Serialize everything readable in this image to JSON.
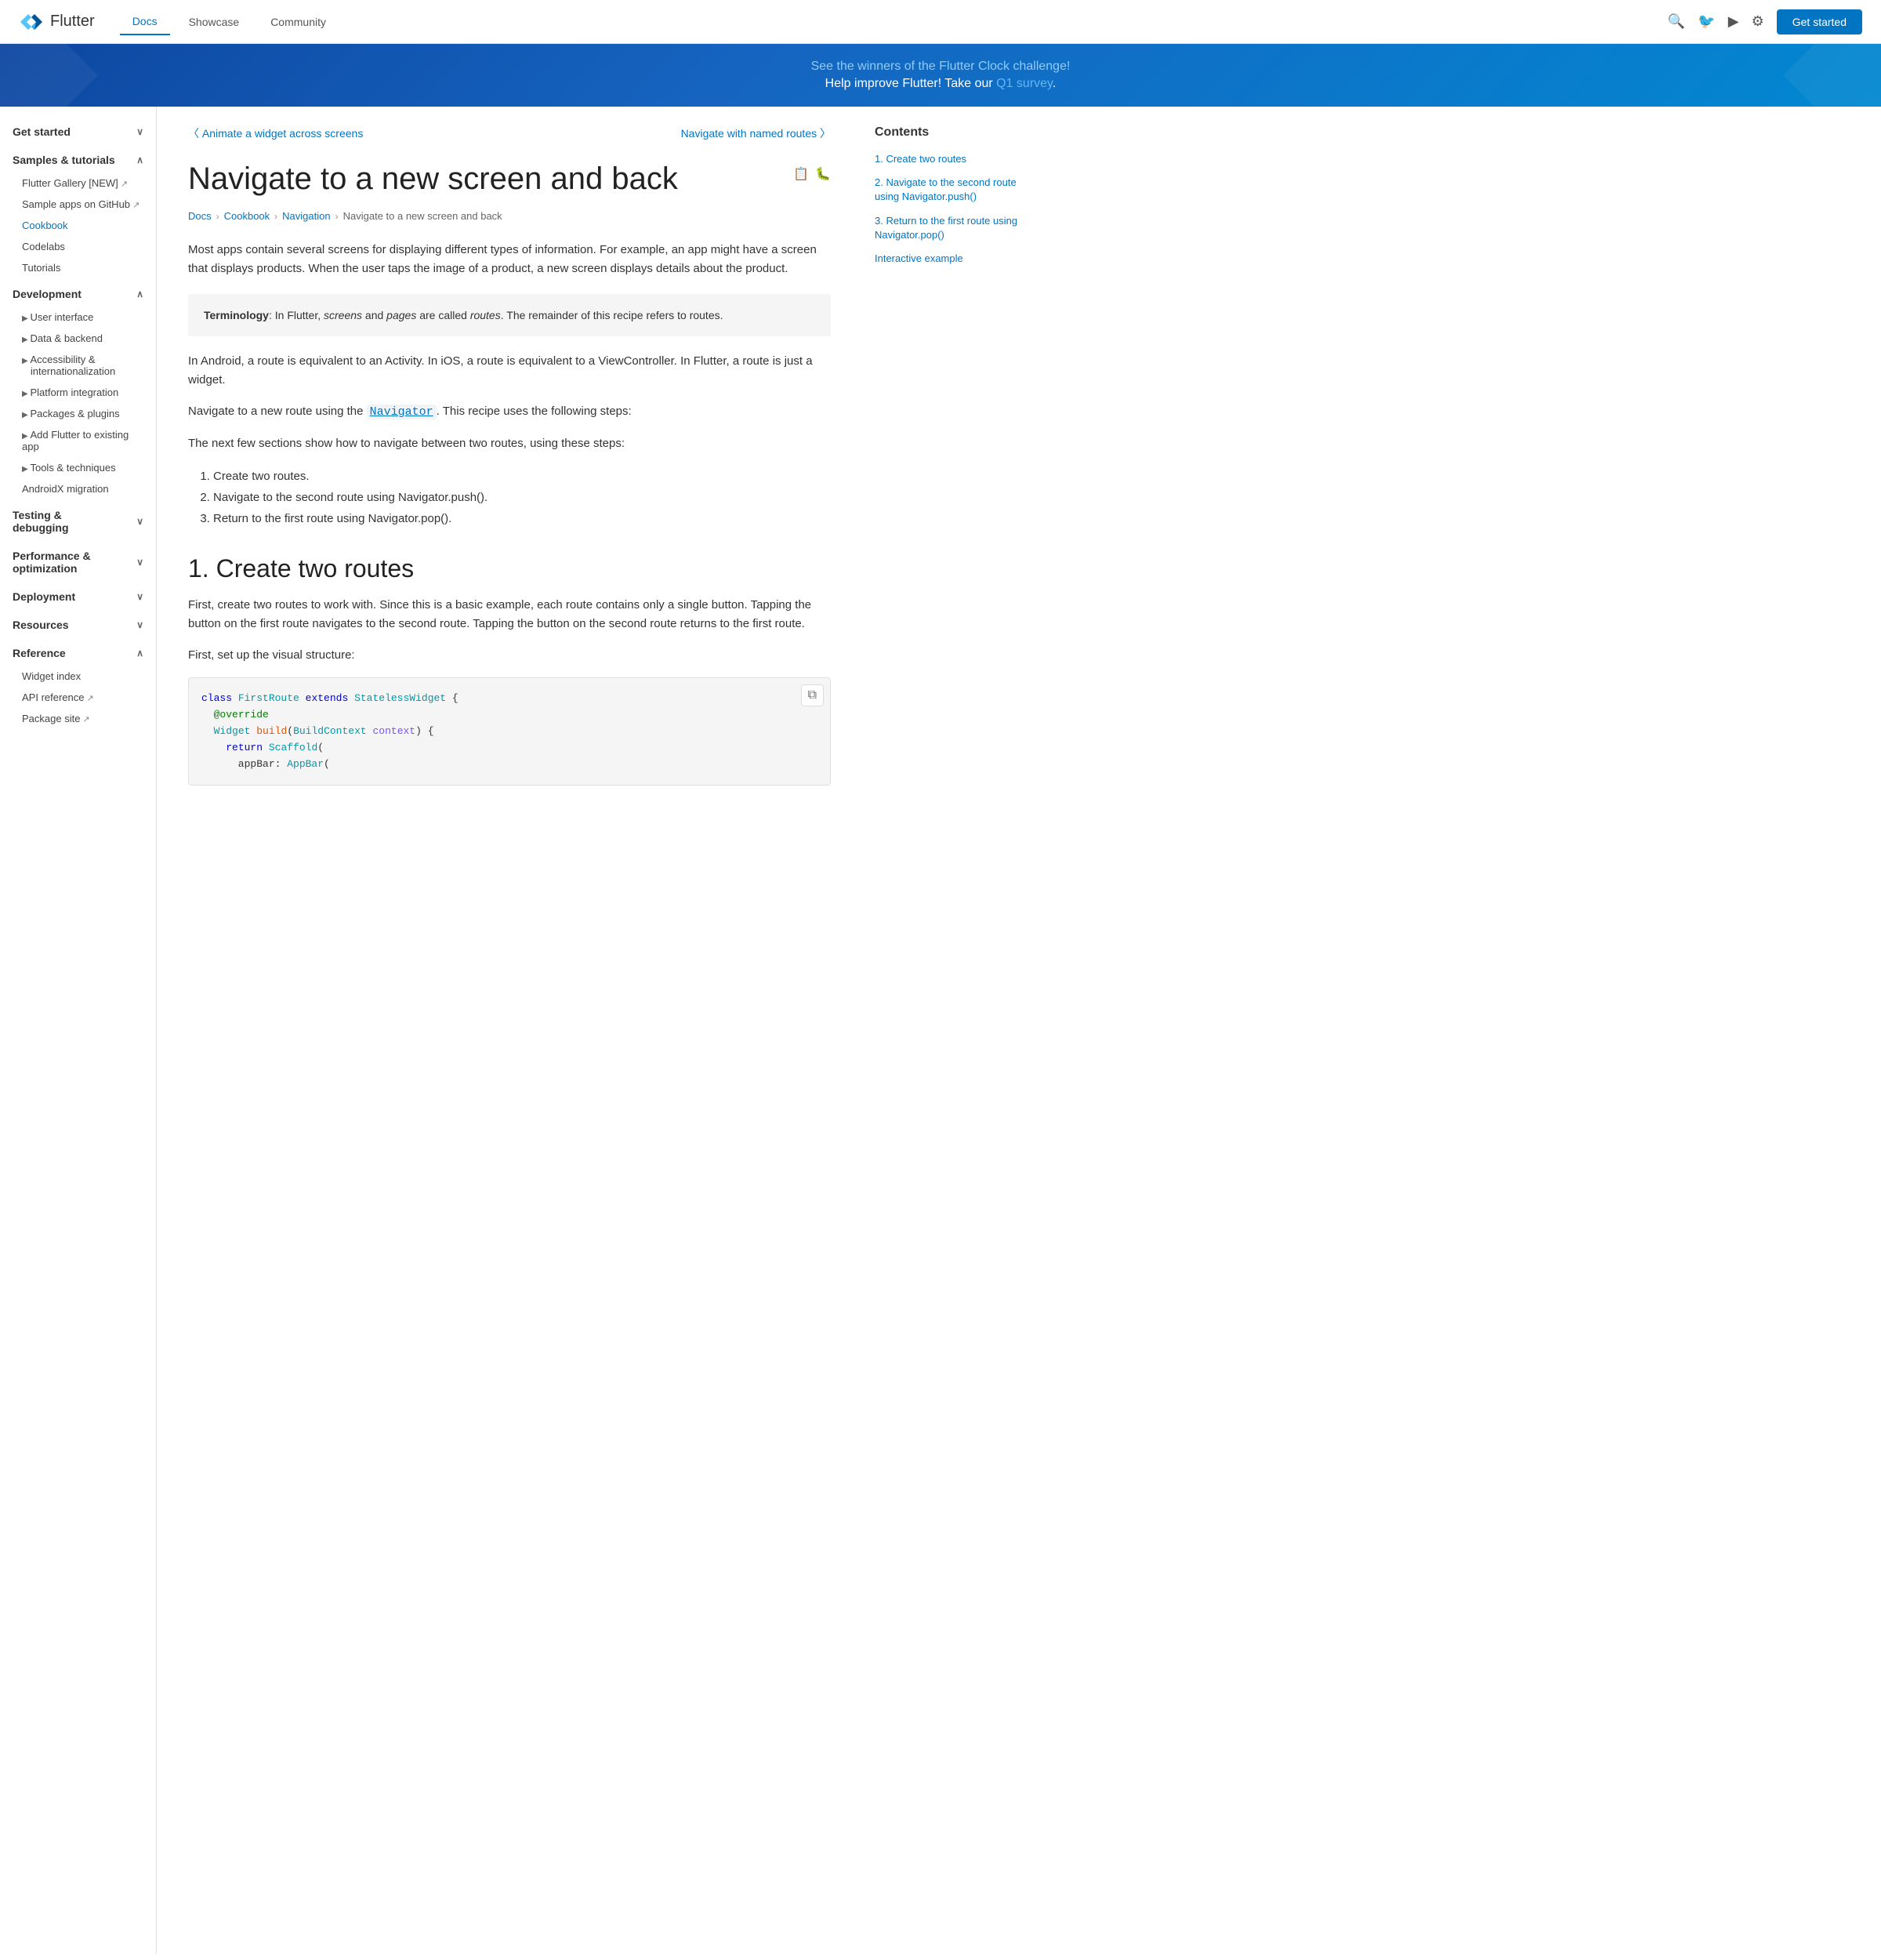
{
  "header": {
    "logo_text": "Flutter",
    "nav_items": [
      {
        "label": "Docs",
        "active": true
      },
      {
        "label": "Showcase",
        "active": false
      },
      {
        "label": "Community",
        "active": false
      }
    ],
    "get_started_label": "Get started"
  },
  "banner": {
    "line1": "See the winners of the Flutter Clock challenge!",
    "line2_prefix": "Help improve Flutter! Take our ",
    "link_text": "Q1 survey",
    "line2_suffix": "."
  },
  "sidebar": {
    "sections": [
      {
        "label": "Get started",
        "expanded": true,
        "items": []
      },
      {
        "label": "Samples & tutorials",
        "expanded": true,
        "items": [
          {
            "label": "Flutter Gallery [NEW]",
            "external": true,
            "active": false
          },
          {
            "label": "Sample apps on GitHub",
            "external": true,
            "active": false
          },
          {
            "label": "Cookbook",
            "active": true,
            "highlight": true
          },
          {
            "label": "Codelabs",
            "active": false
          },
          {
            "label": "Tutorials",
            "active": false
          }
        ]
      },
      {
        "label": "Development",
        "expanded": true,
        "items": [
          {
            "label": "User interface",
            "arrow": true
          },
          {
            "label": "Data & backend",
            "arrow": true
          },
          {
            "label": "Accessibility & internationalization",
            "arrow": true
          },
          {
            "label": "Platform integration",
            "arrow": true
          },
          {
            "label": "Packages & plugins",
            "arrow": true
          },
          {
            "label": "Add Flutter to existing app",
            "arrow": true
          },
          {
            "label": "Tools & techniques",
            "arrow": true
          },
          {
            "label": "AndroidX migration",
            "active": false
          }
        ]
      },
      {
        "label": "Testing & debugging",
        "expanded": true,
        "items": []
      },
      {
        "label": "Performance & optimization",
        "expanded": true,
        "items": []
      },
      {
        "label": "Deployment",
        "expanded": true,
        "items": []
      },
      {
        "label": "Resources",
        "expanded": true,
        "items": []
      },
      {
        "label": "Reference",
        "expanded": true,
        "items": [
          {
            "label": "Widget index",
            "active": false
          },
          {
            "label": "API reference",
            "external": true
          },
          {
            "label": "Package site",
            "external": true
          }
        ]
      }
    ]
  },
  "page": {
    "prev_label": "Animate a widget across screens",
    "next_label": "Navigate with named routes",
    "title": "Navigate to a new screen and back",
    "breadcrumb": [
      "Docs",
      "Cookbook",
      "Navigation",
      "Navigate to a new screen and back"
    ],
    "intro": "Most apps contain several screens for displaying different types of information. For example, an app might have a screen that displays products. When the user taps the image of a product, a new screen displays details about the product.",
    "terminology_bold": "Terminology",
    "terminology_text": ": In Flutter, screens and pages are called routes. The remainder of this recipe refers to routes.",
    "body2": "In Android, a route is equivalent to an Activity. In iOS, a route is equivalent to a ViewController. In Flutter, a route is just a widget.",
    "body3": "Navigate to a new route using the ",
    "navigator_link": "Navigator",
    "body3_suffix": ". This recipe uses the following steps:",
    "body4": "The next few sections show how to navigate between two routes, using these steps:",
    "steps": [
      "Create two routes.",
      "Navigate to the second route using Navigator.push().",
      "Return to the first route using Navigator.pop()."
    ],
    "section1_title": "1. Create two routes",
    "section1_body1": "First, create two routes to work with. Since this is a basic example, each route contains only a single button. Tapping the button on the first route navigates to the second route. Tapping the button on the second route returns to the first route.",
    "section1_body2": "First, set up the visual structure:",
    "code_block": "class FirstRoute extends StatelessWidget {\n  @override\n  Widget build(BuildContext context) {\n    return Scaffold(\n      appBar: AppBar("
  },
  "toc": {
    "title": "Contents",
    "items": [
      {
        "label": "1. Create two routes",
        "href": "#1"
      },
      {
        "label": "2. Navigate to the second route using Navigator.push()",
        "href": "#2"
      },
      {
        "label": "3. Return to the first route using Navigator.pop()",
        "href": "#3"
      },
      {
        "label": "Interactive example",
        "href": "#4"
      }
    ]
  }
}
